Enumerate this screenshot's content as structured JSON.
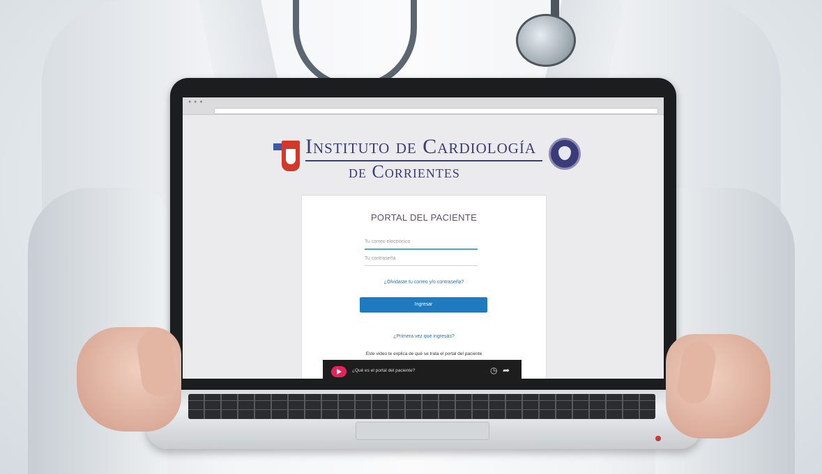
{
  "logo": {
    "line1": "Instituto de Cardiología",
    "line2": "de Corrientes"
  },
  "login": {
    "title": "PORTAL DEL PACIENTE",
    "email_placeholder": "Tu correo electrónico",
    "password_placeholder": "Tu contraseña",
    "forgot_link": "¿Olvidaste tu correo y/o contraseña?",
    "submit_label": "Ingresar",
    "first_time_link": "¿Primera vez que ingresás?",
    "video_intro": "Este video te explica de qué se trata el portal del paciente",
    "video_title": "¿Qué es el portal del paciente?"
  },
  "colors": {
    "brand_navy": "#3c3b7a",
    "brand_red": "#d2392a",
    "button_blue": "#1f7ac0",
    "link_blue": "#2d6fb4"
  }
}
